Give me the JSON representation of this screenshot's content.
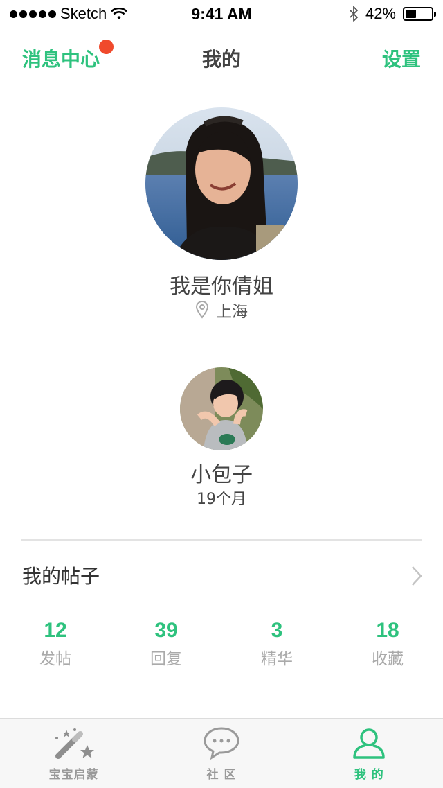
{
  "status_bar": {
    "carrier": "Sketch",
    "time": "9:41 AM",
    "battery_text": "42%",
    "battery_level": 0.42
  },
  "nav": {
    "left_label": "消息中心",
    "title": "我的",
    "right_label": "设置",
    "has_notification_dot": true
  },
  "profile": {
    "name": "我是你倩姐",
    "location": "上海"
  },
  "child": {
    "name": "小包子",
    "age": "19个月"
  },
  "posts": {
    "title": "我的帖子"
  },
  "stats": [
    {
      "value": "12",
      "label": "发帖"
    },
    {
      "value": "39",
      "label": "回复"
    },
    {
      "value": "3",
      "label": "精华"
    },
    {
      "value": "18",
      "label": "收藏"
    }
  ],
  "tabs": [
    {
      "label": "宝宝启蒙",
      "icon": "magic-wand-icon",
      "active": false
    },
    {
      "label": "社 区",
      "icon": "chat-bubble-icon",
      "active": false
    },
    {
      "label": "我 的",
      "icon": "user-icon",
      "active": true
    }
  ],
  "colors": {
    "accent": "#2ec27e",
    "badge": "#f04a2c",
    "inactive": "#999999"
  }
}
